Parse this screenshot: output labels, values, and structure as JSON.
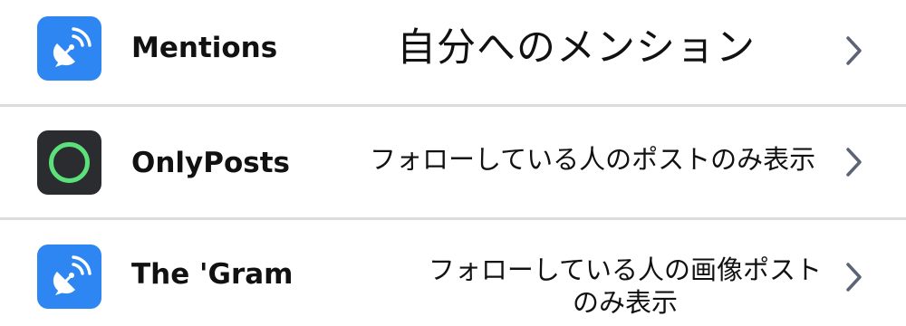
{
  "feeds": [
    {
      "name": "Mentions",
      "description": "自分へのメンション",
      "icon": "satellite-dish-icon",
      "icon_background": "#2e86f3"
    },
    {
      "name": "OnlyPosts",
      "description": "フォローしている人のポストのみ表示",
      "icon": "green-ring-icon",
      "icon_background": "#2a2c30",
      "icon_accent": "#5be07a"
    },
    {
      "name": "The 'Gram",
      "description": "フォローしている人の画像ポストのみ表示",
      "icon": "satellite-dish-icon",
      "icon_background": "#2e86f3"
    }
  ],
  "colors": {
    "divider": "#dcdcde",
    "chevron": "#5b6374",
    "text": "#111111"
  }
}
